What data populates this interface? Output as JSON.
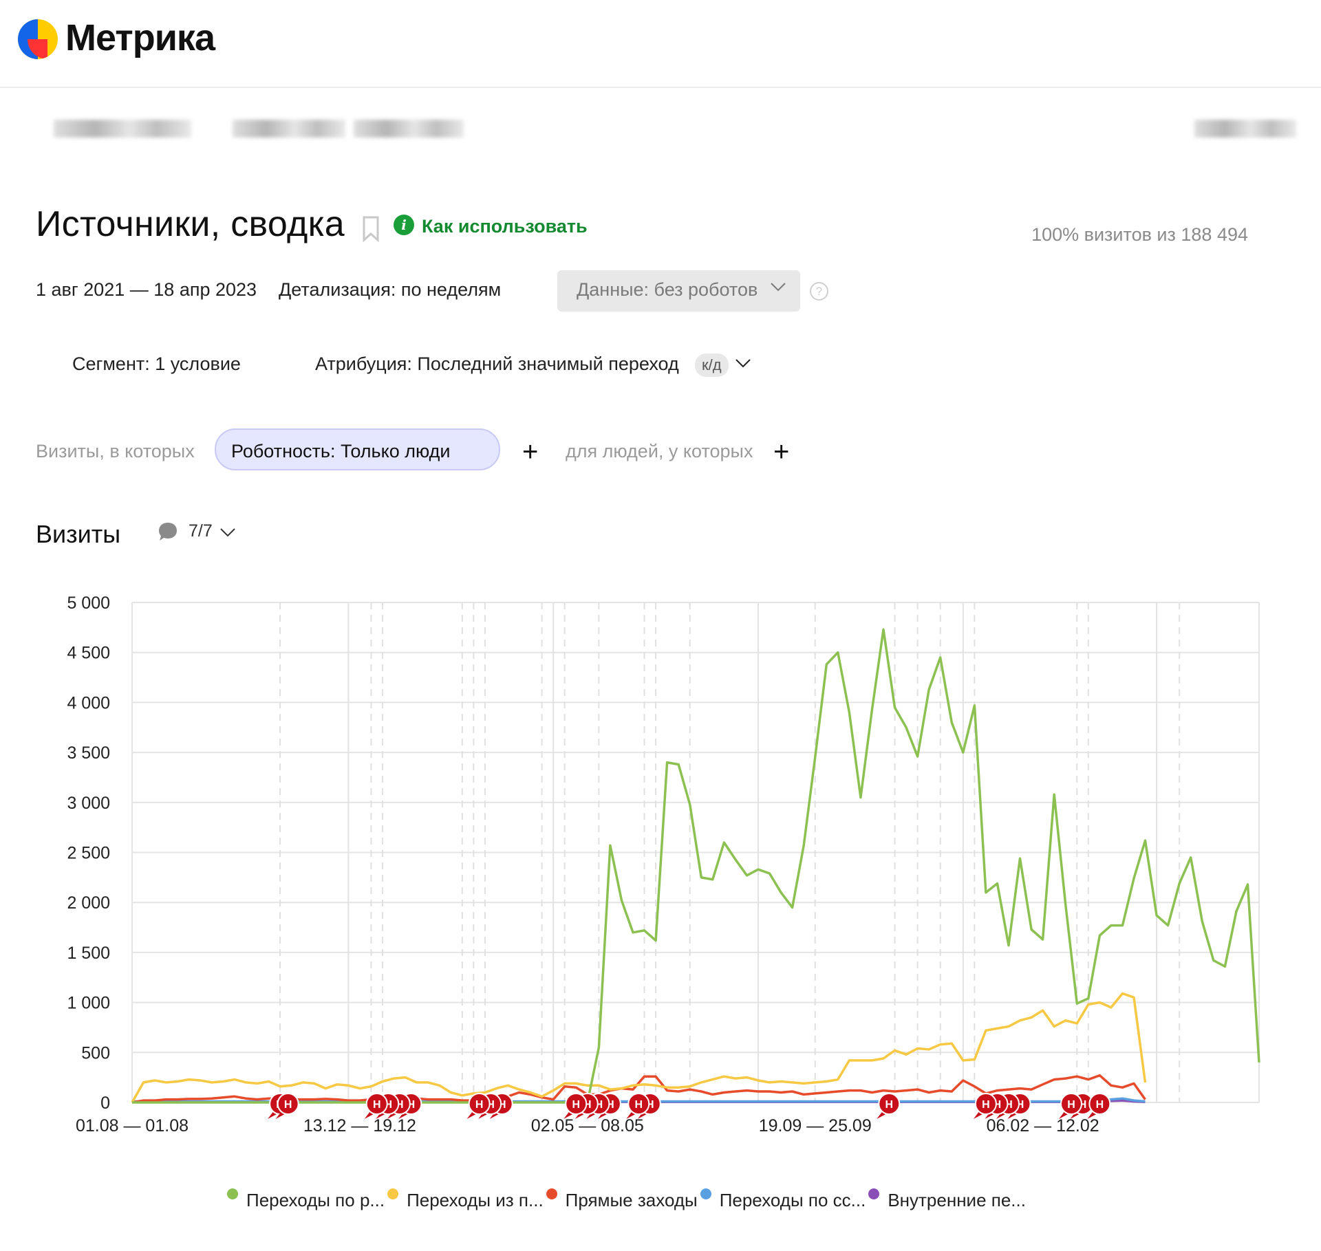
{
  "app": {
    "logo_text": "Метрика"
  },
  "report": {
    "title": "Источники, сводка",
    "howto_link": "Как использовать",
    "visits_share": "100% визитов из 188 494",
    "period": "1 авг 2021 — 18 апр 2023",
    "detail": "Детализация: по неделям",
    "data_filter": "Данные: без роботов",
    "segment": "Сегмент: 1 условие",
    "attribution": "Атрибуция: Последний значимый переход",
    "attribution_badge": "к/д",
    "visits_in_label": "Визиты, в которых",
    "filter_chip": "Роботность: Только люди",
    "for_people_label": "для людей, у которых"
  },
  "chart_section": {
    "title": "Визиты",
    "comments_count": "7/7"
  },
  "icons": [
    "bookmark-icon",
    "info-icon",
    "chevron-down-icon",
    "help-icon",
    "plus-icon",
    "comment-icon",
    "note-marker-icon"
  ],
  "note_marker_label": "Н",
  "chart_data": {
    "type": "line",
    "x_ticks": [
      "01.08 — 01.08",
      "13.12 — 19.12",
      "02.05 — 08.05",
      "19.09 — 25.09",
      "06.02 — 12.02"
    ],
    "ylim": [
      0,
      5000
    ],
    "y_ticks": [
      "0",
      "500",
      "1 000",
      "1 500",
      "2 000",
      "2 500",
      "3 000",
      "3 500",
      "4 000",
      "4 500",
      "5 000"
    ],
    "grid": true,
    "legend_position": "bottom",
    "series": [
      {
        "name": "Переходы по р...",
        "color": "#8cc152",
        "values": [
          0,
          0,
          0,
          0,
          0,
          0,
          0,
          0,
          0,
          0,
          0,
          0,
          0,
          0,
          0,
          0,
          0,
          0,
          0,
          0,
          0,
          0,
          0,
          0,
          0,
          0,
          0,
          0,
          0,
          0,
          0,
          0,
          0,
          0,
          0,
          0,
          0,
          0,
          0,
          0,
          0,
          550,
          2570,
          2020,
          1700,
          1720,
          1620,
          3400,
          3380,
          2980,
          2250,
          2230,
          2600,
          2430,
          2270,
          2330,
          2290,
          2100,
          1950,
          2570,
          3450,
          4380,
          4500,
          3900,
          3050,
          3930,
          4730,
          3950,
          3750,
          3460,
          4130,
          4450,
          3800,
          3500,
          3970,
          2100,
          2190,
          1570,
          2440,
          1730,
          1630,
          3080,
          1980,
          990,
          1040,
          1670,
          1770,
          1770,
          2240,
          2620,
          1870,
          1770,
          2190,
          2450,
          1810,
          1420,
          1360,
          1910,
          2180,
          400
        ]
      },
      {
        "name": "Переходы из п...",
        "color": "#f6c844",
        "values": [
          0,
          200,
          220,
          200,
          210,
          230,
          220,
          200,
          210,
          230,
          200,
          190,
          210,
          160,
          170,
          200,
          190,
          140,
          180,
          170,
          140,
          160,
          210,
          240,
          250,
          200,
          200,
          170,
          100,
          70,
          90,
          100,
          140,
          170,
          130,
          100,
          60,
          120,
          190,
          190,
          170,
          170,
          130,
          140,
          170,
          180,
          170,
          150,
          150,
          160,
          200,
          230,
          260,
          240,
          250,
          220,
          200,
          210,
          200,
          190,
          200,
          210,
          230,
          420,
          420,
          420,
          440,
          520,
          480,
          540,
          530,
          580,
          590,
          420,
          430,
          720,
          740,
          760,
          820,
          850,
          920,
          760,
          820,
          790,
          980,
          1000,
          950,
          1090,
          1050,
          200
        ]
      },
      {
        "name": "Прямые заходы",
        "color": "#e64b2c",
        "values": [
          0,
          20,
          20,
          30,
          30,
          35,
          35,
          40,
          50,
          60,
          40,
          30,
          40,
          40,
          30,
          30,
          30,
          35,
          30,
          20,
          20,
          30,
          30,
          30,
          40,
          40,
          30,
          30,
          30,
          20,
          20,
          40,
          30,
          60,
          100,
          80,
          50,
          30,
          160,
          150,
          80,
          80,
          120,
          140,
          130,
          260,
          260,
          120,
          110,
          130,
          110,
          80,
          100,
          110,
          120,
          110,
          110,
          100,
          110,
          80,
          90,
          100,
          110,
          120,
          120,
          100,
          120,
          110,
          120,
          130,
          100,
          120,
          110,
          220,
          160,
          90,
          120,
          130,
          140,
          130,
          180,
          230,
          240,
          260,
          230,
          270,
          170,
          150,
          190,
          30
        ]
      },
      {
        "name": "Переходы по сс...",
        "color": "#5aa0e0",
        "values": [
          10,
          10,
          10,
          10,
          10,
          10,
          10,
          10,
          10,
          10,
          10,
          10,
          10,
          10,
          10,
          10,
          10,
          10,
          10,
          10,
          10,
          10,
          10,
          10,
          10,
          10,
          10,
          10,
          10,
          10,
          10,
          10,
          10,
          10,
          10,
          10,
          10,
          10,
          10,
          10,
          10,
          10,
          10,
          10,
          10,
          10,
          10,
          10,
          10,
          10,
          10,
          10,
          10,
          10,
          10,
          10,
          10,
          10,
          10,
          10,
          10,
          10,
          10,
          10,
          10,
          10,
          10,
          10,
          10,
          10,
          10,
          10,
          10,
          10,
          10,
          10,
          10,
          10,
          10,
          10,
          10,
          10,
          10,
          10,
          10,
          10,
          30,
          40,
          20,
          10
        ]
      },
      {
        "name": "Внутренние пе...",
        "color": "#8a4fb7",
        "values": [
          5,
          5,
          5,
          5,
          5,
          5,
          5,
          5,
          5,
          5,
          5,
          5,
          5,
          5,
          5,
          5,
          5,
          5,
          5,
          5,
          5,
          5,
          5,
          5,
          5,
          5,
          5,
          5,
          5,
          5,
          5,
          5,
          5,
          5,
          5,
          5,
          5,
          5,
          5,
          5,
          5,
          5,
          5,
          5,
          5,
          5,
          5,
          5,
          5,
          5,
          5,
          5,
          5,
          5,
          5,
          5,
          5,
          5,
          5,
          5,
          5,
          5,
          5,
          5,
          5,
          5,
          5,
          5,
          5,
          5,
          5,
          5,
          5,
          5,
          5,
          5,
          5,
          5,
          5,
          5,
          5,
          5,
          5,
          5,
          5,
          5,
          15,
          20,
          10,
          5
        ]
      }
    ]
  }
}
